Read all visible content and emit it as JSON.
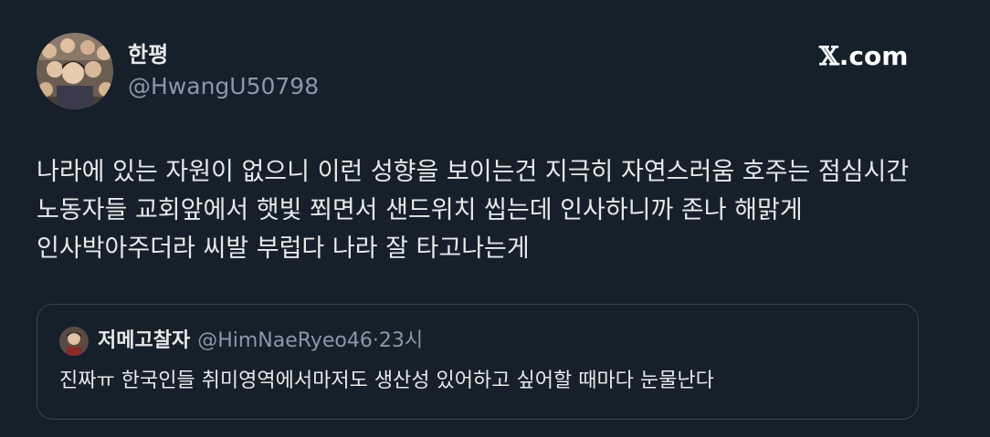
{
  "author": {
    "display_name": "한평",
    "handle": "@HwangU50798",
    "avatar_icon": "group-photo-avatar"
  },
  "brand": {
    "x_glyph": "𝕏",
    "domain": ".com"
  },
  "tweet": {
    "text": "나라에 있는 자원이 없으니 이런 성향을 보이는건 지극히 자연스러움 호주는 점심시간 노동자들 교회앞에서 햇빛 쬐면서 샌드위치 씹는데 인사하니까 존나 해맑게 인사박아주더라 씨발 부럽다 나라 잘 타고나는게"
  },
  "quote": {
    "display_name": "저메고찰자",
    "handle": "@HimNaeRyeo46",
    "separator": "·",
    "time": "23시",
    "text": "진짜ㅠ 한국인들 취미영역에서마저도 생산성 있어하고 싶어할 때마다 눈물난다",
    "avatar_icon": "person-avatar"
  },
  "colors": {
    "background": "#15202b",
    "primary_text": "#e7e9ea",
    "secondary_text": "#8b98a5",
    "border": "#38444d"
  }
}
